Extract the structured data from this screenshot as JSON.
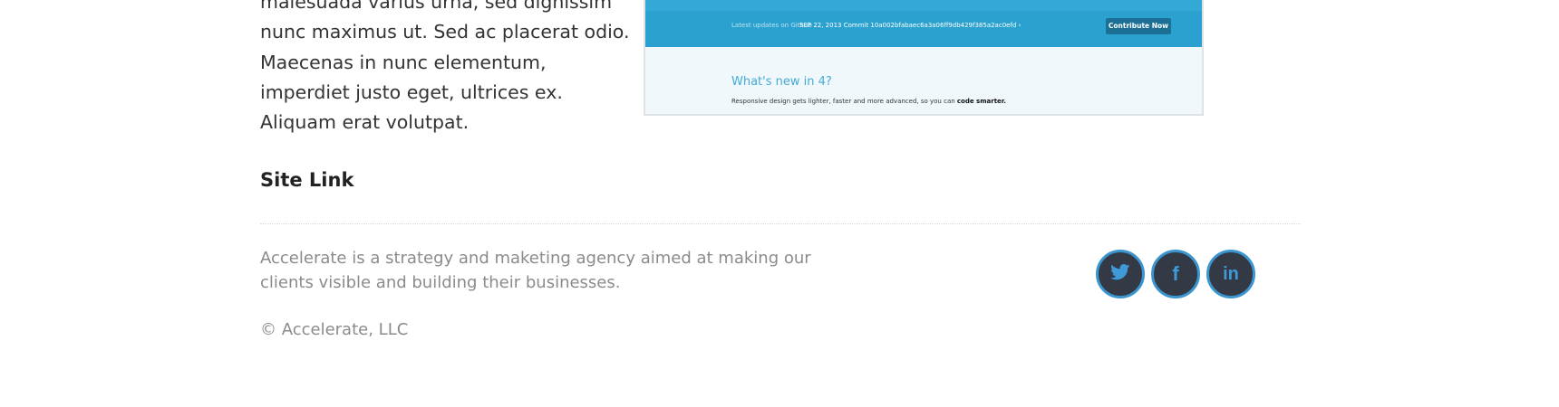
{
  "content": {
    "paragraph_lines": [
      "malesuada varius urna, sed dignissim",
      "nunc maximus ut. Sed ac placerat odio.",
      "Maecenas in nunc elementum,",
      "imperdiet justo eget, ultrices ex.",
      "Aliquam erat volutpat."
    ],
    "site_link_label": "Site Link"
  },
  "preview": {
    "updates_label": "Latest updates on Github",
    "commit_text": "SEP 22, 2013 Commit 10a002bfabaec6a3a06ff9db429f385a2ac0efd ›",
    "contribute_label": "Contribute Now",
    "heading": "What's new in 4?",
    "subtext": "Responsive design gets lighter, faster and more advanced, so you can ",
    "subtext_bold": "code smarter."
  },
  "footer": {
    "about_lines": [
      "Accelerate is a strategy and maketing agency aimed at making our",
      "clients visible and building their businesses."
    ],
    "copyright": "© Accelerate, LLC",
    "social": [
      {
        "icon": "twitter-icon",
        "glyph": "🐦"
      },
      {
        "icon": "facebook-icon",
        "glyph": "f"
      },
      {
        "icon": "linkedin-icon",
        "glyph": "in"
      }
    ],
    "colors": {
      "social_bg": "#343a45",
      "social_accent": "#3a95d0",
      "footer_text": "#8b8b8b"
    }
  }
}
